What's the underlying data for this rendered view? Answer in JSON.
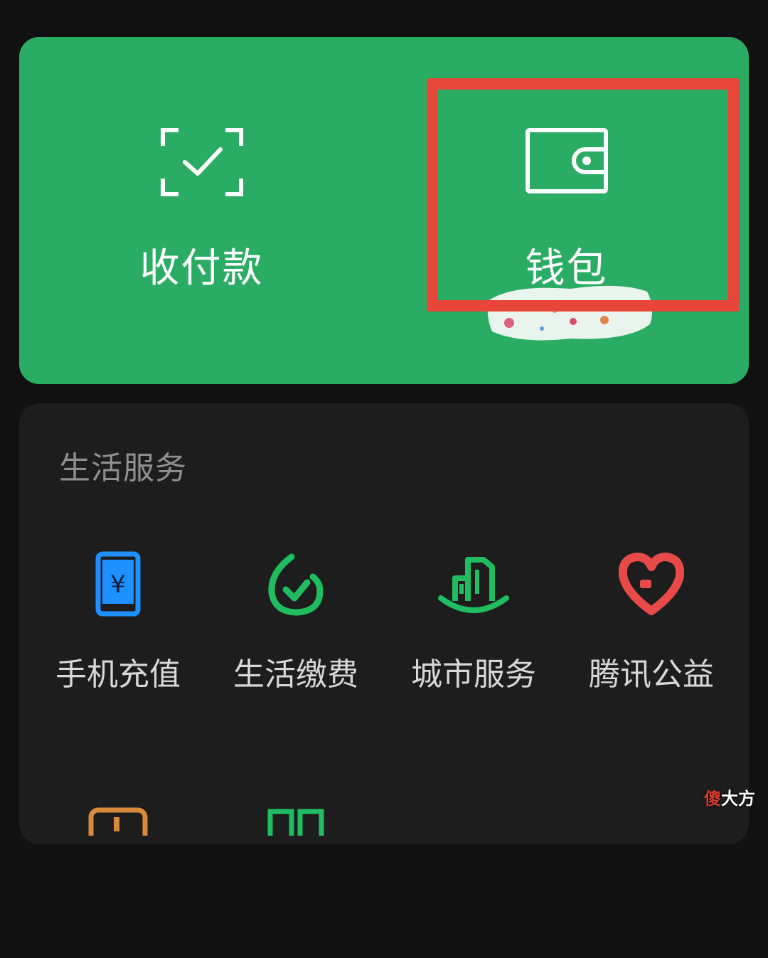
{
  "top_actions": {
    "pay_label": "收付款",
    "wallet_label": "钱包"
  },
  "colors": {
    "brand_green": "#2aac65",
    "highlight_red": "#e8463a",
    "phone_blue": "#1e90ff",
    "service_green": "#1fbd5f",
    "charity_red": "#e84a4a"
  },
  "services": {
    "title": "生活服务",
    "items": [
      {
        "label": "手机充值",
        "icon": "phone-topup-icon"
      },
      {
        "label": "生活缴费",
        "icon": "utility-payment-icon"
      },
      {
        "label": "城市服务",
        "icon": "city-services-icon"
      },
      {
        "label": "腾讯公益",
        "icon": "charity-heart-icon"
      }
    ]
  },
  "watermark": {
    "prefix": "傻",
    "rest": "大方"
  }
}
